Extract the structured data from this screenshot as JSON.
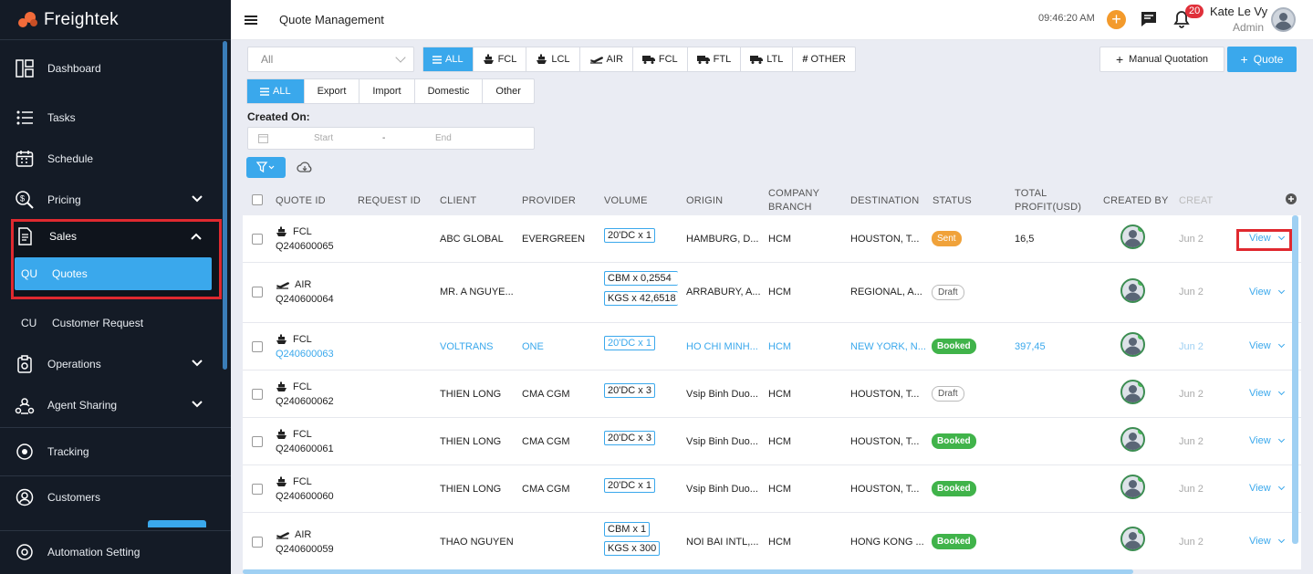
{
  "app": {
    "brand": "Freightek",
    "brand_color": "#f26b3a",
    "accent": "#3aa8ec"
  },
  "sidebar": {
    "items": [
      {
        "label": "Dashboard",
        "icon": "dashboard-icon"
      },
      {
        "label": "Tasks",
        "icon": "tasks-icon"
      },
      {
        "label": "Schedule",
        "icon": "calendar-icon"
      },
      {
        "label": "Pricing",
        "icon": "pricing-icon"
      },
      {
        "label": "Sales",
        "icon": "sales-icon"
      },
      {
        "label": "Operations",
        "icon": "operations-icon"
      },
      {
        "label": "Agent Sharing",
        "icon": "agent-sharing-icon"
      },
      {
        "label": "Tracking",
        "icon": "tracking-icon"
      },
      {
        "label": "Customers",
        "icon": "customers-icon"
      },
      {
        "label": "Automation Setting",
        "icon": "automation-icon"
      }
    ],
    "sub_items": [
      {
        "abbr": "QU",
        "label": "Quotes"
      },
      {
        "abbr": "CU",
        "label": "Customer Request"
      }
    ]
  },
  "header": {
    "title": "Quote Management",
    "time": "09:46:20 AM",
    "notifications": "20",
    "user_name": "Kate Le Vy",
    "user_role": "Admin"
  },
  "toolbar": {
    "select_value": "All",
    "mode_tabs": [
      "ALL",
      "FCL",
      "LCL",
      "AIR",
      "FCL",
      "FTL",
      "LTL",
      "OTHER"
    ],
    "type_tabs": [
      "ALL",
      "Export",
      "Import",
      "Domestic",
      "Other"
    ],
    "manual_label": "Manual Quotation",
    "quote_label": "Quote",
    "created_on_label": "Created On:",
    "start_placeholder": "Start",
    "date_sep": "-",
    "end_placeholder": "End"
  },
  "table": {
    "headers": [
      "QUOTE ID",
      "REQUEST ID",
      "CLIENT",
      "PROVIDER",
      "VOLUME",
      "ORIGIN",
      "COMPANY BRANCH",
      "DESTINATION",
      "STATUS",
      "TOTAL PROFIT(USD)",
      "CREATED BY",
      "CREAT"
    ],
    "rows": [
      {
        "mode": "FCL",
        "id": "Q240600065",
        "client": "ABC GLOBAL",
        "provider": "EVERGREEN",
        "volumes": [
          "20'DC x 1"
        ],
        "origin": "HAMBURG, D...",
        "branch": "HCM",
        "destination": "HOUSTON, T...",
        "status": "Sent",
        "profit": "16,5",
        "created": "Jun 2",
        "view": "View"
      },
      {
        "mode": "AIR",
        "id": "Q240600064",
        "client": "MR. A NGUYE...",
        "provider": "",
        "volumes": [
          "CBM x 0,2554",
          "KGS x 42,6518"
        ],
        "origin": "ARRABURY, A...",
        "branch": "HCM",
        "destination": "REGIONAL, A...",
        "status": "Draft",
        "profit": "",
        "created": "Jun 2",
        "view": "View"
      },
      {
        "mode": "FCL",
        "id": "Q240600063",
        "client": "VOLTRANS",
        "provider": "ONE",
        "volumes": [
          "20'DC x 1"
        ],
        "origin": "HO CHI MINH...",
        "branch": "HCM",
        "destination": "NEW YORK, N...",
        "status": "Booked",
        "profit": "397,45",
        "created": "Jun 2",
        "view": "View"
      },
      {
        "mode": "FCL",
        "id": "Q240600062",
        "client": "THIEN LONG",
        "provider": "CMA CGM",
        "volumes": [
          "20'DC x 3"
        ],
        "origin": "Vsip Binh Duo...",
        "branch": "HCM",
        "destination": "HOUSTON, T...",
        "status": "Draft",
        "profit": "",
        "created": "Jun 2",
        "view": "View"
      },
      {
        "mode": "FCL",
        "id": "Q240600061",
        "client": "THIEN LONG",
        "provider": "CMA CGM",
        "volumes": [
          "20'DC x 3"
        ],
        "origin": "Vsip Binh Duo...",
        "branch": "HCM",
        "destination": "HOUSTON, T...",
        "status": "Booked",
        "profit": "",
        "created": "Jun 2",
        "view": "View"
      },
      {
        "mode": "FCL",
        "id": "Q240600060",
        "client": "THIEN LONG",
        "provider": "CMA CGM",
        "volumes": [
          "20'DC x 1"
        ],
        "origin": "Vsip Binh Duo...",
        "branch": "HCM",
        "destination": "HOUSTON, T...",
        "status": "Booked",
        "profit": "",
        "created": "Jun 2",
        "view": "View"
      },
      {
        "mode": "AIR",
        "id": "Q240600059",
        "client": "THAO NGUYEN",
        "provider": "",
        "volumes": [
          "CBM x 1",
          "KGS x 300"
        ],
        "origin": "NOI BAI INTL,...",
        "branch": "HCM",
        "destination": "HONG KONG ...",
        "status": "Booked",
        "profit": "",
        "created": "Jun 2",
        "view": "View"
      }
    ]
  }
}
